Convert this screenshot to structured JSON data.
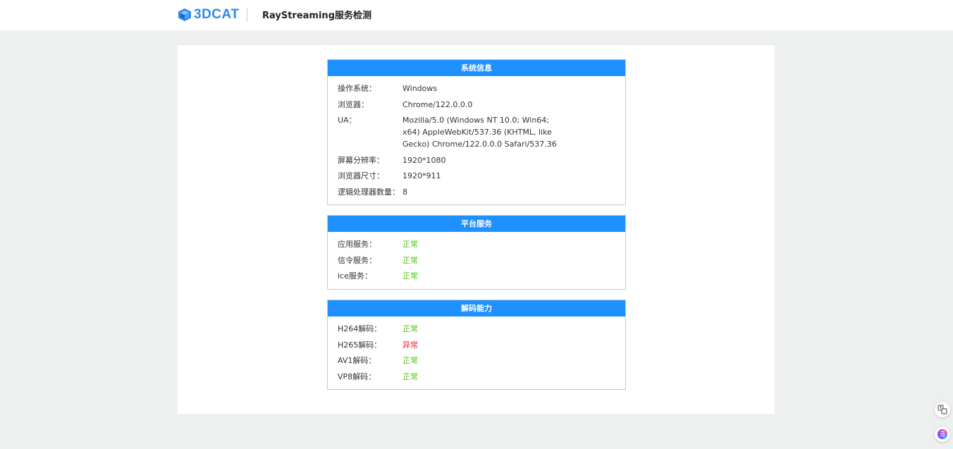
{
  "header": {
    "brand": "3DCAT",
    "title": "RayStreaming服务检测"
  },
  "sections": {
    "system": {
      "title": "系统信息",
      "rows": [
        {
          "label": "操作系统：",
          "value": "Windows"
        },
        {
          "label": "浏览器：",
          "value": "Chrome/122.0.0.0"
        },
        {
          "label": "UA：",
          "value": "Mozilla/5.0 (Windows NT 10.0; Win64; x64) AppleWebKit/537.36 (KHTML, like Gecko) Chrome/122.0.0.0 Safari/537.36"
        },
        {
          "label": "屏幕分辨率：",
          "value": "1920*1080"
        },
        {
          "label": "浏览器尺寸：",
          "value": "1920*911"
        },
        {
          "label": "逻辑处理器数量：",
          "value": "8"
        }
      ]
    },
    "platform": {
      "title": "平台服务",
      "rows": [
        {
          "label": "应用服务：",
          "value": "正常"
        },
        {
          "label": "信令服务：",
          "value": "正常"
        },
        {
          "label": "ice服务：",
          "value": "正常"
        }
      ]
    },
    "decode": {
      "title": "解码能力",
      "rows": [
        {
          "label": "H264解码：",
          "value": "正常"
        },
        {
          "label": "H265解码：",
          "value": "异常"
        },
        {
          "label": "AV1解码：",
          "value": "正常"
        },
        {
          "label": "VP8解码：",
          "value": "正常"
        }
      ]
    }
  },
  "colors": {
    "accent": "#1e90ff",
    "ok": "#52c41a",
    "error": "#f5222d"
  },
  "floating": {
    "top_icon": "translate-icon",
    "bottom_icon": "ai-assistant-icon"
  }
}
